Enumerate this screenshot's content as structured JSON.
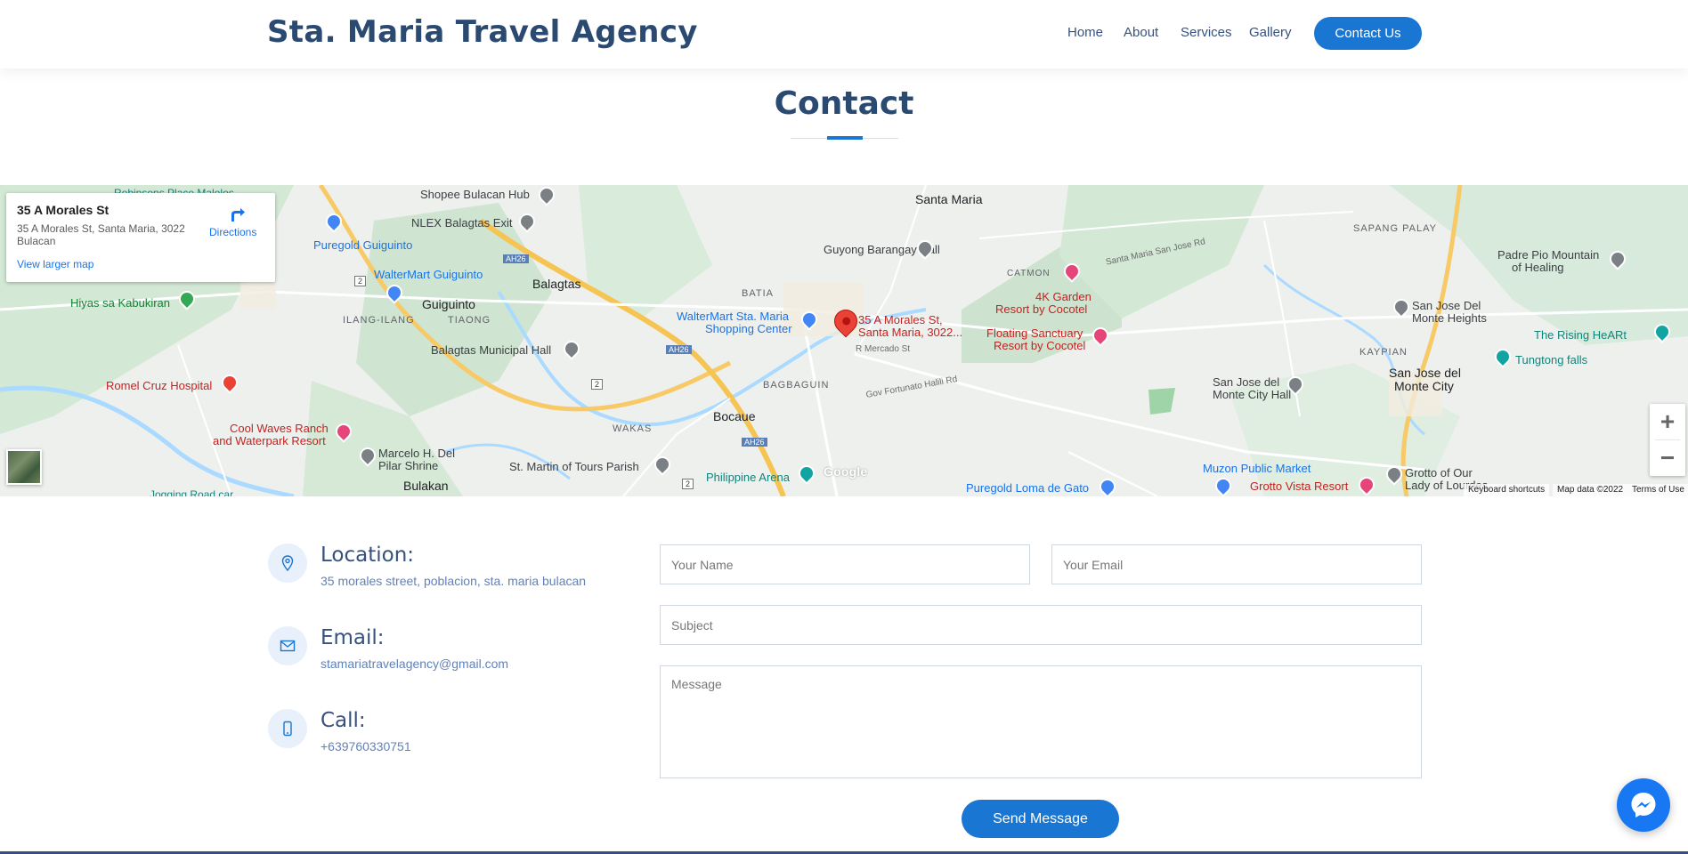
{
  "header": {
    "logo": "Sta. Maria Travel Agency",
    "nav": [
      "Home",
      "About",
      "Services",
      "Gallery"
    ],
    "cta": "Contact Us"
  },
  "section": {
    "title": "Contact"
  },
  "map": {
    "card": {
      "title": "35 A Morales St",
      "address": "35 A Morales St, Santa Maria, 3022 Bulacan",
      "directions": "Directions",
      "larger_map": "View larger map"
    },
    "marker_label_line1": "35 A Morales St,",
    "marker_label_line2": "Santa Maria, 3022...",
    "labels": {
      "santa_maria": "Santa Maria",
      "shopee": "Shopee Bulacan Hub",
      "robinsons": "Robinsons Place Malolos",
      "nlex": "NLEX Balagtas Exit",
      "puregold_guiguinto": "Puregold Guiguinto",
      "guyong": "Guyong Barangay Hall",
      "sapang_palay": "SAPANG PALAY",
      "catmon": "CATMON",
      "sta_maria_sj_rd": "Santa Maria San Jose Rd",
      "padre_pio_1": "Padre Pio Mountain",
      "padre_pio_2": "of Healing",
      "walter_guiguinto": "WalterMart Guiguinto",
      "balagtas": "Balagtas",
      "batia": "BATIA",
      "hiyas": "Hiyas sa Kabukiran",
      "guiguinto": "Guiguinto",
      "ilang": "ILANG-ILANG",
      "tiaong": "TIAONG",
      "walter_sta_1": "WalterMart Sta. Maria",
      "walter_sta_2": "Shopping Center",
      "garden_1": "4K Garden",
      "garden_2": "Resort by Cocotel",
      "sj_heights_1": "San Jose Del",
      "sj_heights_2": "Monte Heights",
      "rising_heart": "The Rising HeARt",
      "floating_1": "Floating Sanctuary",
      "floating_2": "Resort by Cocotel",
      "kaypian": "KAYPIAN",
      "balagtas_hall": "Balagtas Municipal Hall",
      "r_mercado": "R Mercado St",
      "tungtong": "Tungtong falls",
      "sj_monte_1": "San Jose del",
      "sj_monte_2": "Monte City",
      "sj_hall_1": "San Jose del",
      "sj_hall_2": "Monte City Hall",
      "romel": "Romel Cruz Hospital",
      "bagbaguin": "BAGBAGUIN",
      "gov_fortunato": "Gov Fortunato Halili Rd",
      "bocaue": "Bocaue",
      "cool_waves_1": "Cool Waves Ranch",
      "cool_waves_2": "and Waterpark Resort",
      "wakas": "WAKAS",
      "marcelo_1": "Marcelo H. Del",
      "marcelo_2": "Pilar Shrine",
      "st_martin": "St. Martin of Tours Parish",
      "philippine_arena": "Philippine Arena",
      "muzon": "Muzon Public Market",
      "grotto_1": "Grotto of Our",
      "grotto_2": "Lady of Lourdes",
      "bulakan": "Bulakan",
      "grotto_vista": "Grotto Vista Resort",
      "puregold_loma": "Puregold Loma de Gato",
      "jogging": "Jogging Road car",
      "ah26": "AH26",
      "rt2": "2",
      "google": "Google",
      "keyboard": "Keyboard shortcuts",
      "map_data": "Map data ©2022",
      "terms": "Terms of Use"
    },
    "zoom_in": "+",
    "zoom_out": "−"
  },
  "info": {
    "location": {
      "title": "Location:",
      "text": "35 morales street, poblacion, sta. maria bulacan"
    },
    "email": {
      "title": "Email:",
      "text": "stamariatravelagency@gmail.com"
    },
    "call": {
      "title": "Call:",
      "text": "+639760330751"
    }
  },
  "form": {
    "name_placeholder": "Your Name",
    "email_placeholder": "Your Email",
    "subject_placeholder": "Subject",
    "message_placeholder": "Message",
    "send": "Send Message"
  },
  "colors": {
    "accent": "#1976d2",
    "heading": "#37517e",
    "icon_bg": "#e7f0fb"
  },
  "icons": [
    "map-pin-icon",
    "envelope-icon",
    "phone-icon",
    "directions-icon",
    "messenger-icon"
  ]
}
